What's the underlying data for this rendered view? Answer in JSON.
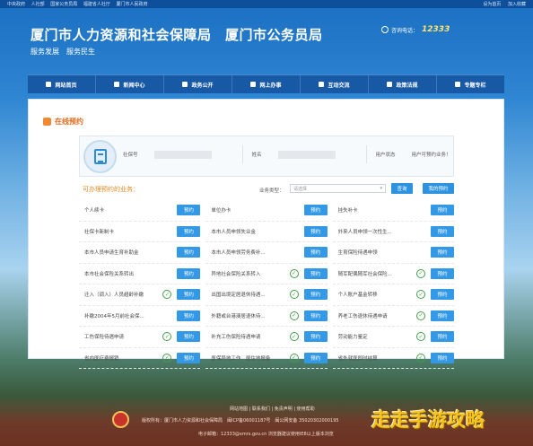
{
  "topbar": {
    "links": [
      "中央政府",
      "人社部",
      "国家公务员局",
      "福建省人社厅",
      "厦门市人民政府"
    ],
    "right": [
      "设为首页",
      "加入收藏"
    ]
  },
  "header": {
    "title": "厦门市人力资源和社会保障局　厦门市公务员局",
    "slogan": "服务发展　服务民生",
    "hotline_label": "咨询电话：",
    "hotline_number": "12333"
  },
  "nav": [
    "网站首页",
    "新闻中心",
    "政务公开",
    "网上办事",
    "互动交流",
    "政策法规",
    "专题专栏"
  ],
  "panel": {
    "title": "在线预约",
    "user": {
      "ssn_label": "社保号",
      "name_label": "姓名",
      "status_label": "用户状态",
      "status_value": "用户可预约业务！"
    },
    "query_label": "可办理预约的业务：",
    "type_label": "业务类型：",
    "type_placeholder": "请选择",
    "query_button": "查询",
    "my_button": "我的预约",
    "book_label": "预约",
    "items": [
      "个人续卡",
      "单位办卡",
      "挂失补卡",
      "社保卡新制卡",
      "本市人员申领失业金",
      "外来人员申领一次性生...",
      "本市人员申请生育补助金",
      "本市人员申领劳务费补...",
      "生育保险待遇申领",
      "本市社会保险关系转出",
      "异地社会保险关系转入",
      "随军配偶随军社会保险...",
      "迁入（调入）人员超龄补缴",
      "出国出境定居退休待遇...",
      "个人账户基金转移",
      "补缴2004年5月前社会保...",
      "外籍或台港澳居退休待...",
      "养老工伤退休待遇申请",
      "工伤保险待遇申请",
      "补充工伤保险待遇申请",
      "劳动能力鉴定",
      "省内医疗费报销",
      "医保异地工作、居住地报备",
      "省外就医即时结算"
    ]
  },
  "footer": {
    "links": "网站地图 | 联系我们 | 免责声明 | 使用帮助",
    "copyright": "版权所有：厦门市人力资源和社会保障局　闽ICP备06001187号　闽公网安备 35020302000195",
    "contact": "电子邮箱：12333@xmrs.gov.cn 浏览器建议使用IE8以上版本浏览"
  },
  "watermark": "走走手游攻略"
}
